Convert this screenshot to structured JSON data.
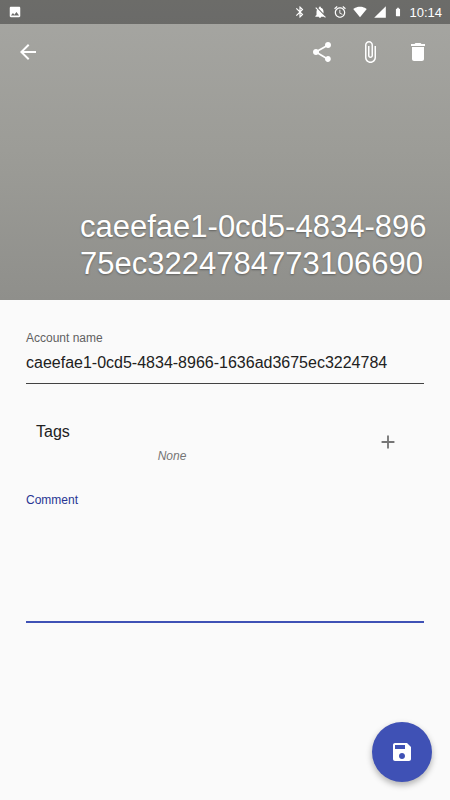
{
  "status_bar": {
    "time": "10:14"
  },
  "header": {
    "title_lines": [
      "caeefae1-0cd5-4834-896",
      "75ec3224784773106690"
    ]
  },
  "account_name": {
    "label": "Account name",
    "value": "caeefae1-0cd5-4834-8966-1636ad3675ec3224784"
  },
  "tags": {
    "label": "Tags",
    "value": "None"
  },
  "comment": {
    "label": "Comment"
  }
}
